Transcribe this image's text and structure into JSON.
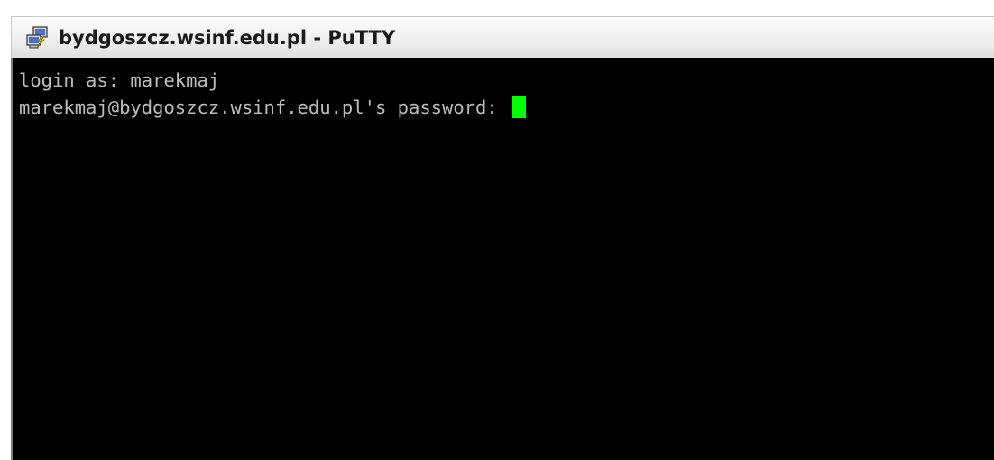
{
  "window": {
    "title": "bydgoszcz.wsinf.edu.pl - PuTTY",
    "icon": "putty-icon"
  },
  "terminal": {
    "lines": [
      "login as: marekmaj",
      "marekmaj@bydgoszcz.wsinf.edu.pl's password: "
    ],
    "cursor_color": "#00ff00",
    "text_color": "#bdbdbd",
    "background_color": "#000000"
  }
}
